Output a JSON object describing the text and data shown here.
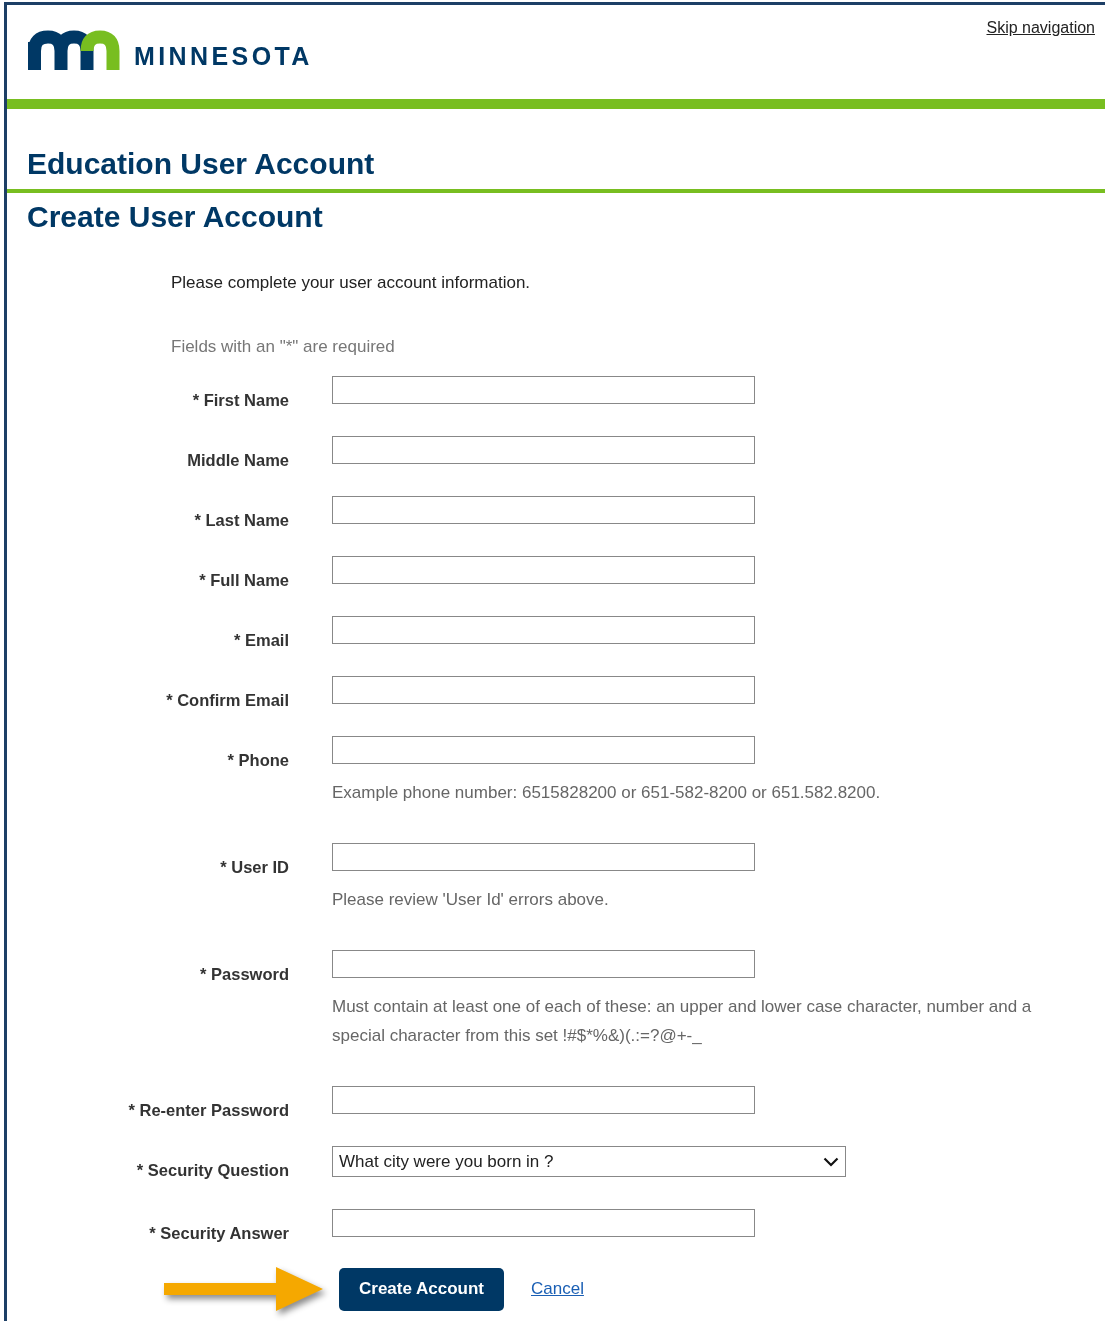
{
  "header": {
    "logo_text": "MINNESOTA",
    "skip_link": "Skip navigation"
  },
  "app_title": "Education User Account",
  "page_title": "Create User Account",
  "intro": "Please complete your user account information.",
  "required_note": "Fields with an \"*\" are required",
  "fields": [
    {
      "kind": "text",
      "label": "* First Name"
    },
    {
      "kind": "text",
      "label": "Middle Name"
    },
    {
      "kind": "text",
      "label": "* Last Name"
    },
    {
      "kind": "text",
      "label": "* Full Name"
    },
    {
      "kind": "text",
      "label": "* Email"
    },
    {
      "kind": "text",
      "label": "* Confirm Email"
    },
    {
      "kind": "text",
      "label": "* Phone",
      "hint": "Example phone number: 6515828200 or 651-582-8200 or 651.582.8200."
    },
    {
      "kind": "text",
      "label": "* User ID",
      "hint": "Please review 'User Id' errors above."
    },
    {
      "kind": "text",
      "label": "* Password",
      "hint": "Must contain at least one of each of these: an upper and lower case character, number and a special character from this set !#$*%&)(.:=?@+-_"
    },
    {
      "kind": "text",
      "label": "* Re-enter Password"
    },
    {
      "kind": "select",
      "label": "* Security Question",
      "value": "What city were you born in ?"
    },
    {
      "kind": "text",
      "label": "* Security Answer"
    }
  ],
  "actions": {
    "submit": "Create Account",
    "cancel": "Cancel"
  }
}
